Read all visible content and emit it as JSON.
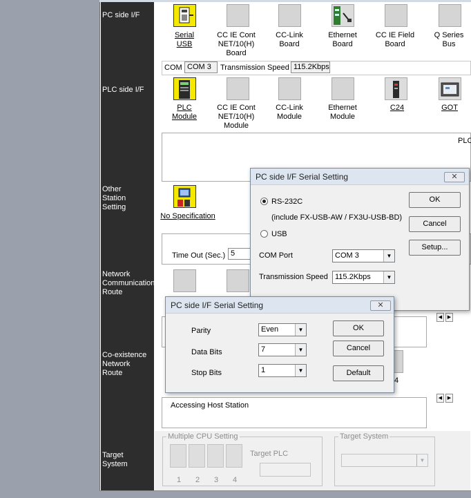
{
  "sidebar": {
    "pc_side_if": "PC side I/F",
    "plc_side_if": "PLC side I/F",
    "other_station": "Other\nStation\nSetting",
    "network_route": "Network\nCommunication\nRoute",
    "coexistence_route": "Co-existence\nNetwork\nRoute",
    "target_system": "Target\nSystem"
  },
  "pc_side": {
    "icons": [
      {
        "label": "Serial\nUSB",
        "icon": "serial-usb-icon",
        "selected": true
      },
      {
        "label": "CC IE Cont\nNET/10(H)\nBoard",
        "icon": "cc-ie-cont-board-icon"
      },
      {
        "label": "CC-Link\nBoard",
        "icon": "cc-link-board-icon"
      },
      {
        "label": "Ethernet\nBoard",
        "icon": "ethernet-board-icon"
      },
      {
        "label": "CC IE Field\nBoard",
        "icon": "cc-ie-field-board-icon"
      },
      {
        "label": "Q Series\nBus",
        "icon": "q-series-bus-icon"
      }
    ],
    "status": {
      "com_label": "COM",
      "com_value": "COM 3",
      "speed_label": "Transmission Speed",
      "speed_value": "115.2Kbps"
    }
  },
  "plc_side": {
    "icons": [
      {
        "label": "PLC\nModule",
        "icon": "plc-module-icon",
        "selected": true
      },
      {
        "label": "CC IE Cont\nNET/10(H)\nModule",
        "icon": "cc-ie-cont-module-icon"
      },
      {
        "label": "CC-Link\nModule",
        "icon": "cc-link-module-icon"
      },
      {
        "label": "Ethernet\nModule",
        "icon": "ethernet-module-icon"
      },
      {
        "label": "C24",
        "icon": "c24-icon"
      },
      {
        "label": "GOT",
        "icon": "got-icon"
      }
    ],
    "info_text": "PLC"
  },
  "other_station": {
    "icon_label": "No Specification",
    "timeout_label": "Time Out (Sec.)",
    "timeout_value": "5"
  },
  "coexistence": {
    "partial_label": "4"
  },
  "accessing_host": "Accessing Host Station",
  "target_system": {
    "multiple_cpu_title": "Multiple CPU Setting",
    "cpu_numbers": [
      "1",
      "2",
      "3",
      "4"
    ],
    "target_plc_label": "Target PLC",
    "target_system_title": "Target System"
  },
  "dialog1": {
    "title": "PC side I/F Serial Setting",
    "rs232c_label": "RS-232C",
    "rs232c_note": "(include FX-USB-AW / FX3U-USB-BD)",
    "usb_label": "USB",
    "com_port_label": "COM Port",
    "com_port_value": "COM 3",
    "speed_label": "Transmission Speed",
    "speed_value": "115.2Kbps",
    "ok": "OK",
    "cancel": "Cancel",
    "setup": "Setup...",
    "close": "✕"
  },
  "dialog2": {
    "title": "PC side I/F Serial Setting",
    "parity_label": "Parity",
    "parity_value": "Even",
    "data_bits_label": "Data Bits",
    "data_bits_value": "7",
    "stop_bits_label": "Stop Bits",
    "stop_bits_value": "1",
    "ok": "OK",
    "cancel": "Cancel",
    "default": "Default",
    "close": "✕"
  },
  "colors": {
    "sidebar": "#2d2d2d",
    "selected_tile": "#f6e900",
    "desktop": "#9aa0ac"
  }
}
